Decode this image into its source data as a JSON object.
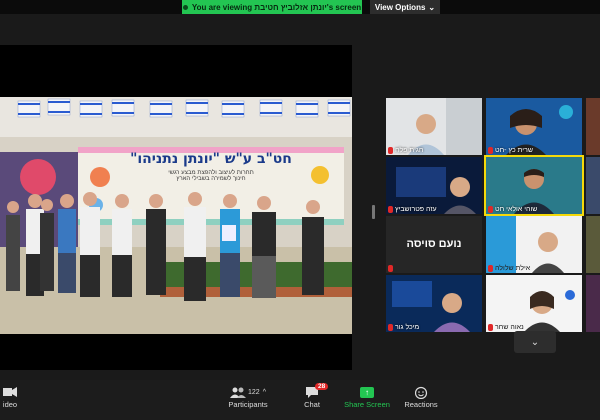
{
  "banner": {
    "text": "You are viewing יונתן אזלוביץ חטיבת's screen",
    "view_options": "View Options"
  },
  "shared_screen": {
    "photo_sign_title": "חט\"ב ע\"ש \"יונתן נתניהו\"",
    "photo_sign_line1": "תחרות לעיצוב ולהפצת מבצע רגשי",
    "photo_sign_line2": "חינוך לשמירה בשבילי הארץ"
  },
  "participants": [
    {
      "name": "חגית פלח"
    },
    {
      "name": "שרית כץ -חט"
    },
    {
      "name": "עזה פטרושביץ"
    },
    {
      "name": "שוהי אולאי חט"
    },
    {
      "name": "נועם סויסה"
    },
    {
      "name": "אילת שלולה"
    },
    {
      "name": "מיכל גור"
    },
    {
      "name": "נאוה שחר"
    }
  ],
  "toolbar": {
    "video_label": "ideo",
    "participants_label": "Participants",
    "participants_count": "122",
    "chat_label": "Chat",
    "chat_badge": "28",
    "share_label": "Share Screen",
    "reactions_label": "Reactions"
  },
  "colors": {
    "accent_green": "#23c552",
    "active_speaker": "#f5d90a",
    "mic_muted": "#e02828"
  }
}
